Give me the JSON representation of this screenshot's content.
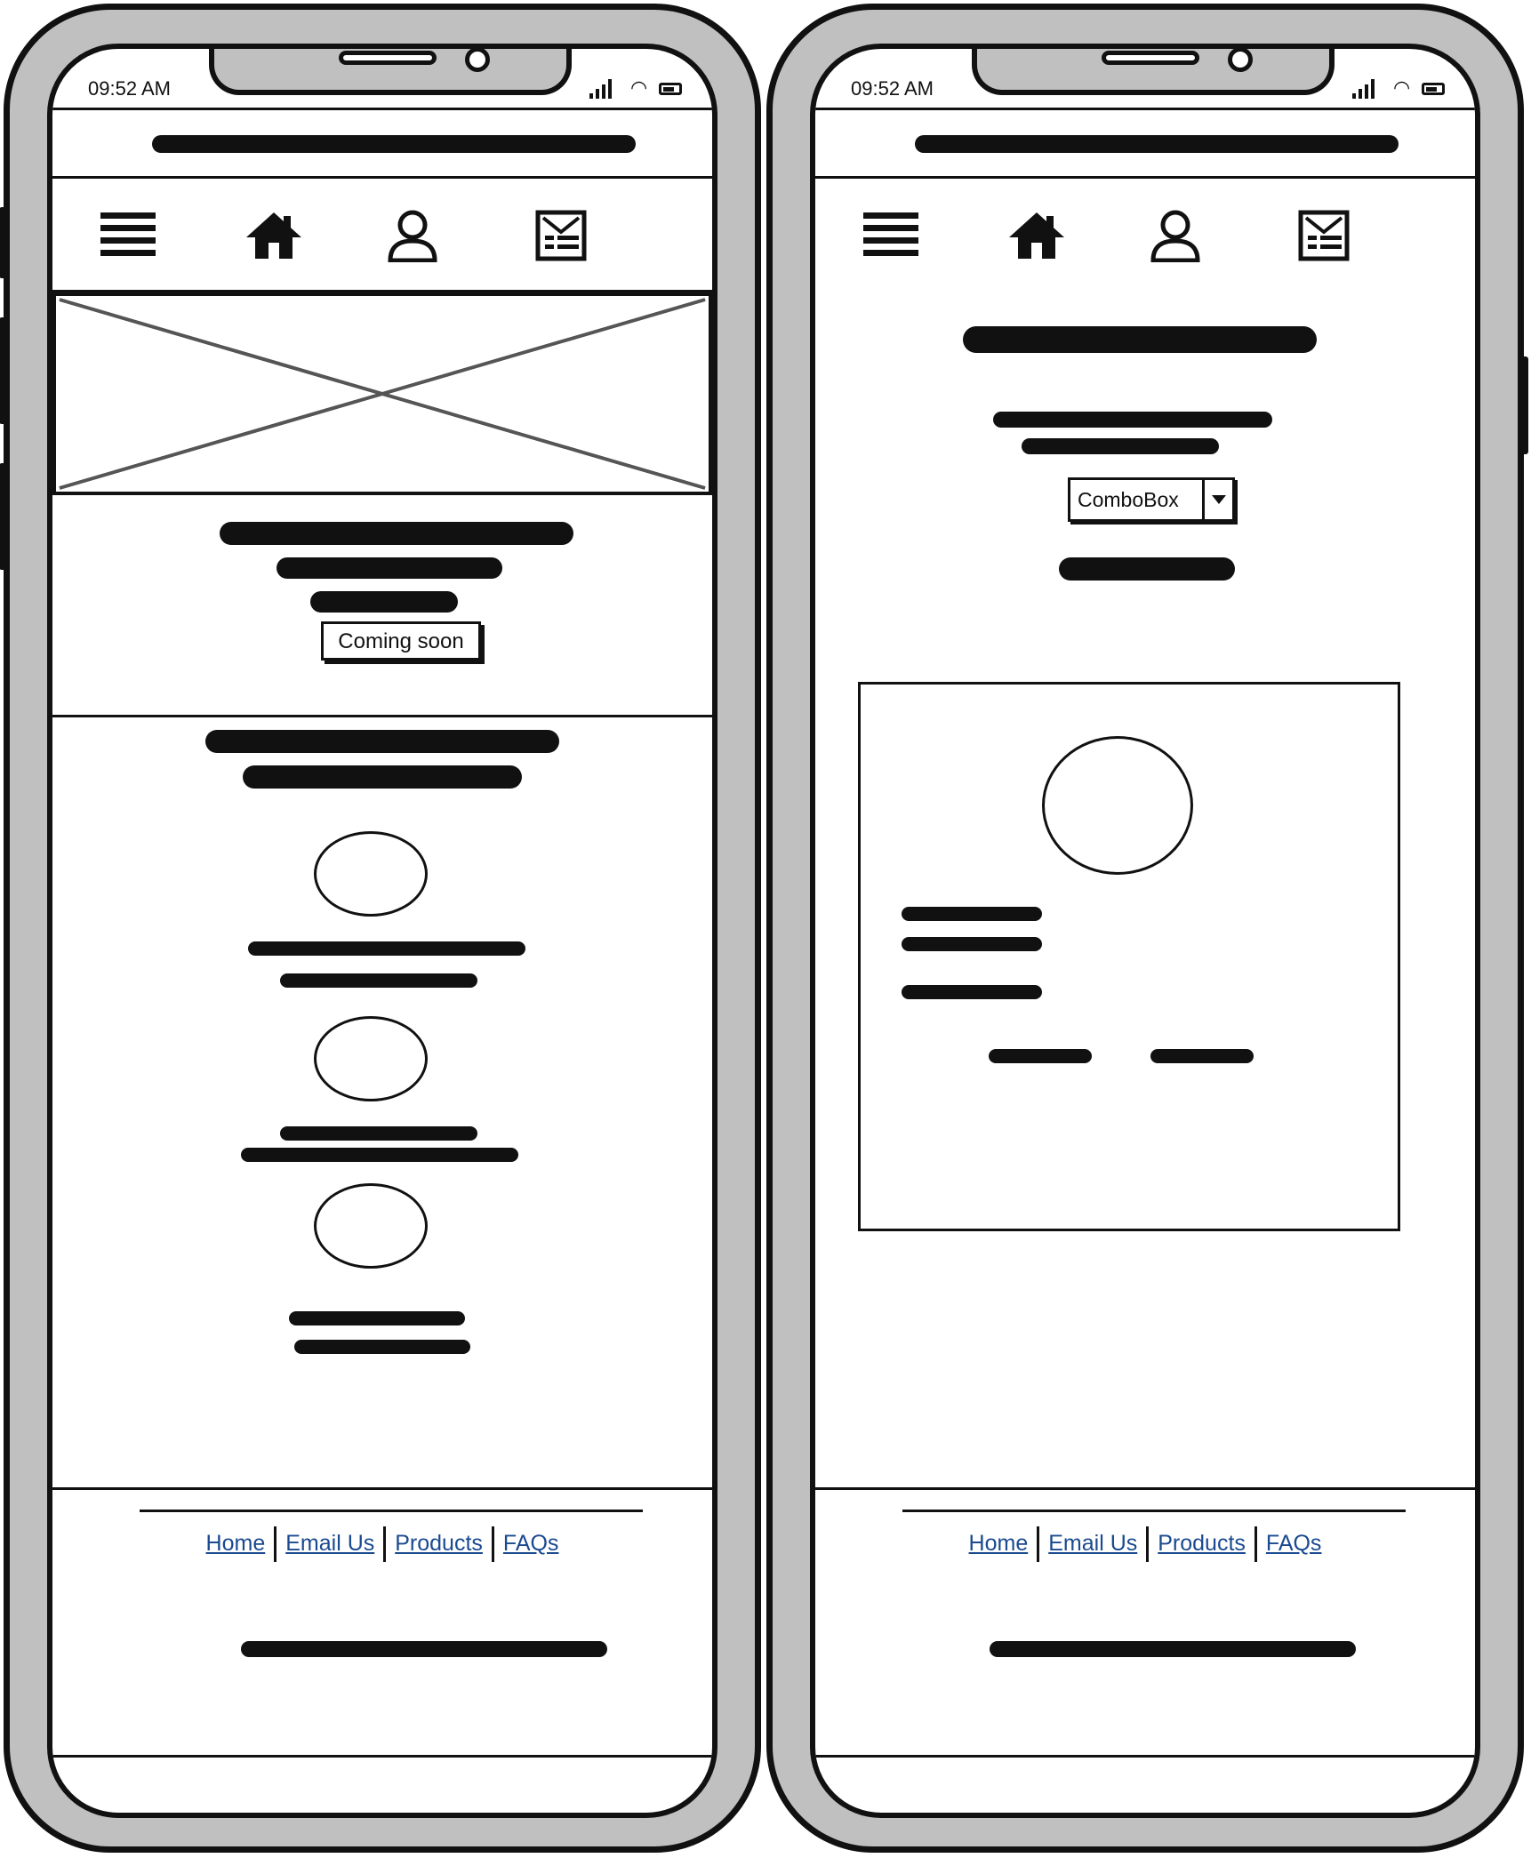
{
  "status_bar": {
    "time": "09:52 AM"
  },
  "nav_icons": [
    "menu-icon",
    "home-icon",
    "user-icon",
    "news-icon"
  ],
  "left_screen": {
    "hero": {
      "button_label": "Coming soon"
    }
  },
  "right_screen": {
    "combobox": {
      "value": "ComboBox"
    }
  },
  "footer": {
    "links": [
      "Home",
      "Email Us",
      "Products",
      "FAQs"
    ],
    "link_color": "#1a4a8f"
  }
}
